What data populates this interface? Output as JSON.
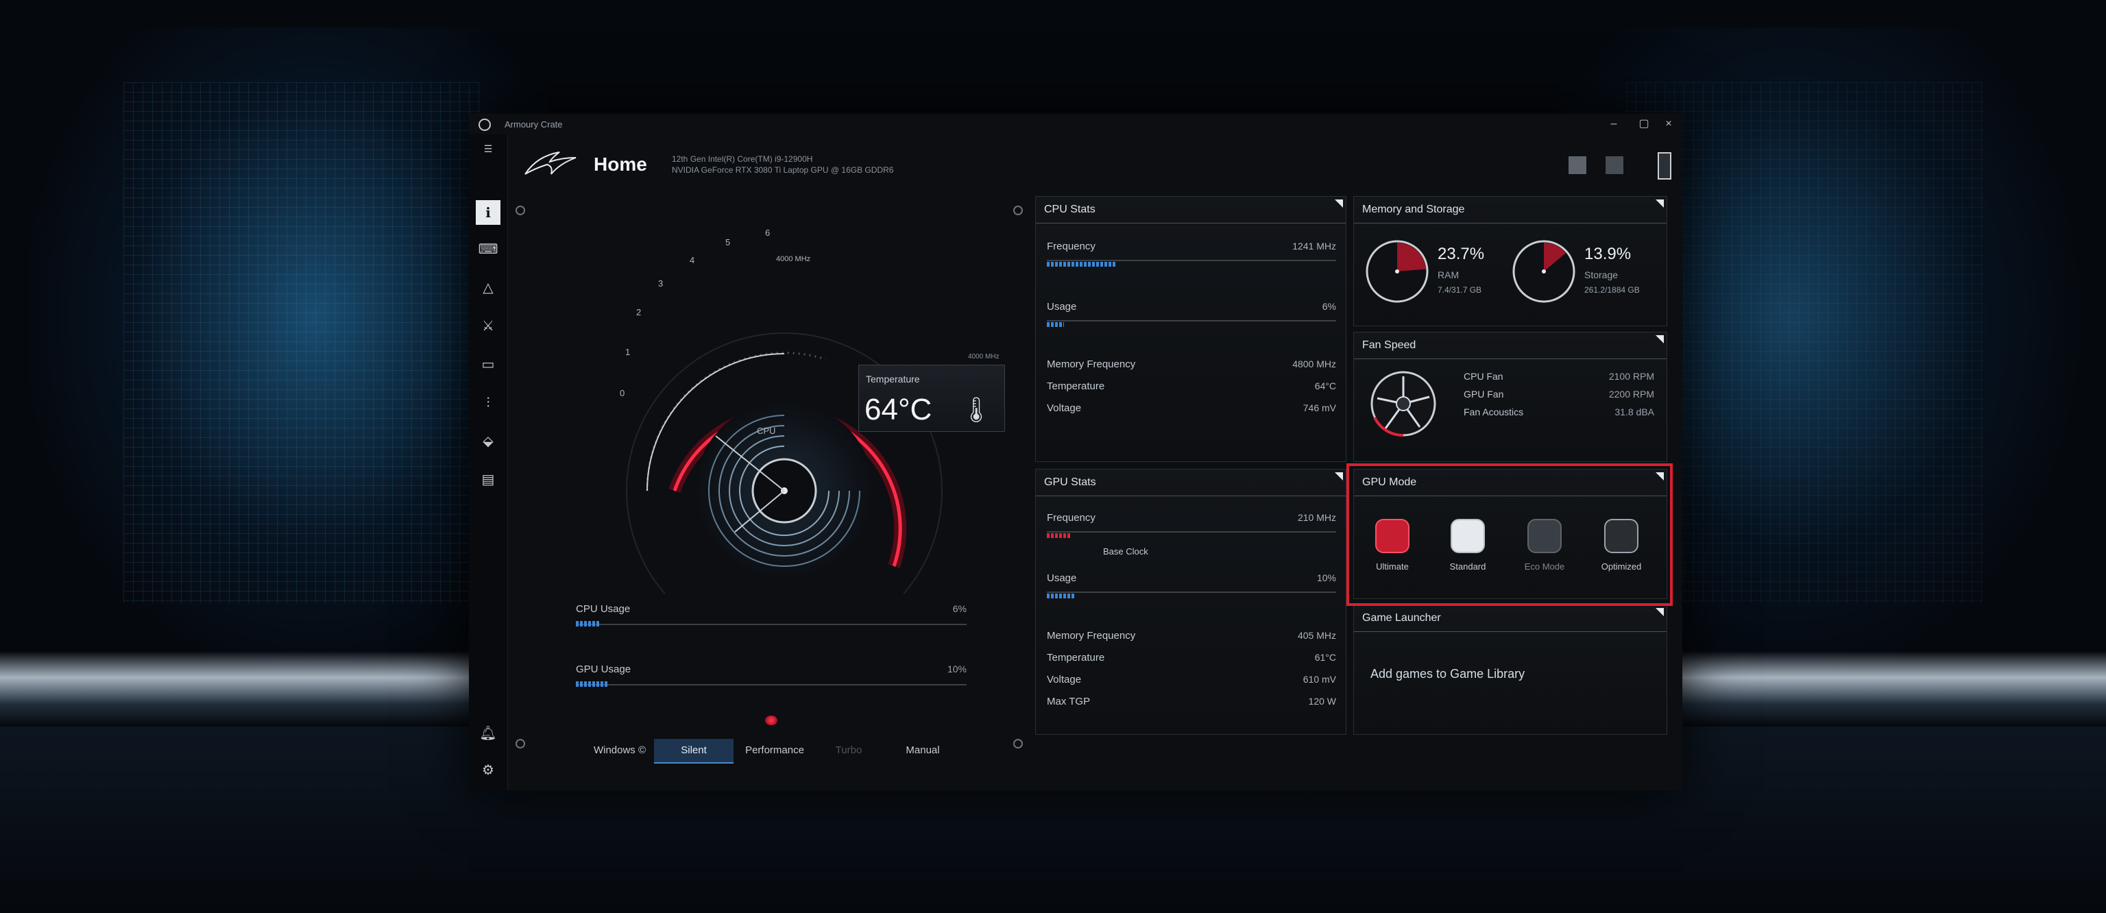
{
  "window": {
    "app_name": "Armoury Crate",
    "minimize": "–",
    "maximize": "▢",
    "close": "×"
  },
  "header": {
    "title": "Home",
    "sysinfo_line1": "12th Gen Intel(R) Core(TM) i9-12900H",
    "sysinfo_line2": "NVIDIA GeForce RTX 3080 Ti Laptop GPU @ 16GB GDDR6"
  },
  "gauge": {
    "numbers": [
      "0",
      "1",
      "2",
      "3",
      "4",
      "5",
      "6"
    ],
    "top_readout": "4000 MHz",
    "temp_top": "4000 MHz",
    "temp_label": "Temperature",
    "temp_value": "64°C",
    "caption": "CPU"
  },
  "usage": {
    "cpu_label": "CPU Usage",
    "cpu_value": "6%",
    "cpu_fraction": 0.06,
    "gpu_label": "GPU Usage",
    "gpu_value": "10%",
    "gpu_fraction": 0.08
  },
  "modes": {
    "windows": "Windows ©",
    "silent": "Silent",
    "performance": "Performance",
    "turbo": "Turbo",
    "manual": "Manual"
  },
  "cpu_stats": {
    "title": "CPU Stats",
    "frequency_label": "Frequency",
    "frequency_value": "1241 MHz",
    "frequency_fraction": 0.24,
    "usage_label": "Usage",
    "usage_value": "6%",
    "usage_fraction": 0.06,
    "mem_freq_label": "Memory Frequency",
    "mem_freq_value": "4800 MHz",
    "temp_label": "Temperature",
    "temp_value": "64°C",
    "voltage_label": "Voltage",
    "voltage_value": "746 mV"
  },
  "gpu_stats": {
    "title": "GPU Stats",
    "frequency_label": "Frequency",
    "frequency_value": "210 MHz",
    "frequency_fraction": 0.08,
    "base_clock_label": "Base Clock",
    "usage_label": "Usage",
    "usage_value": "10%",
    "usage_fraction": 0.1,
    "mem_freq_label": "Memory Frequency",
    "mem_freq_value": "405 MHz",
    "temp_label": "Temperature",
    "temp_value": "61°C",
    "voltage_label": "Voltage",
    "voltage_value": "610 mV",
    "tgp_label": "Max TGP",
    "tgp_value": "120 W"
  },
  "memory": {
    "title": "Memory and Storage",
    "ram_pct": "23.7%",
    "ram_label": "RAM",
    "ram_detail": "7.4/31.7 GB",
    "ram_fraction": 0.237,
    "storage_pct": "13.9%",
    "storage_label": "Storage",
    "storage_detail": "261.2/1884 GB",
    "storage_fraction": 0.139
  },
  "fan": {
    "title": "Fan Speed",
    "cpu_fan_label": "CPU Fan",
    "cpu_fan_value": "2100 RPM",
    "gpu_fan_label": "GPU Fan",
    "gpu_fan_value": "2200 RPM",
    "acoustics_label": "Fan Acoustics",
    "acoustics_value": "31.8 dBA"
  },
  "gpu_mode": {
    "title": "GPU Mode",
    "items": [
      "Ultimate",
      "Standard",
      "Eco Mode",
      "Optimized"
    ]
  },
  "game_launcher": {
    "title": "Game Launcher",
    "add_text": "Add games to Game Library"
  },
  "colors": {
    "accent_red": "#e0223b",
    "accent_blue": "#3b86d8",
    "highlight": "#d8202f"
  }
}
